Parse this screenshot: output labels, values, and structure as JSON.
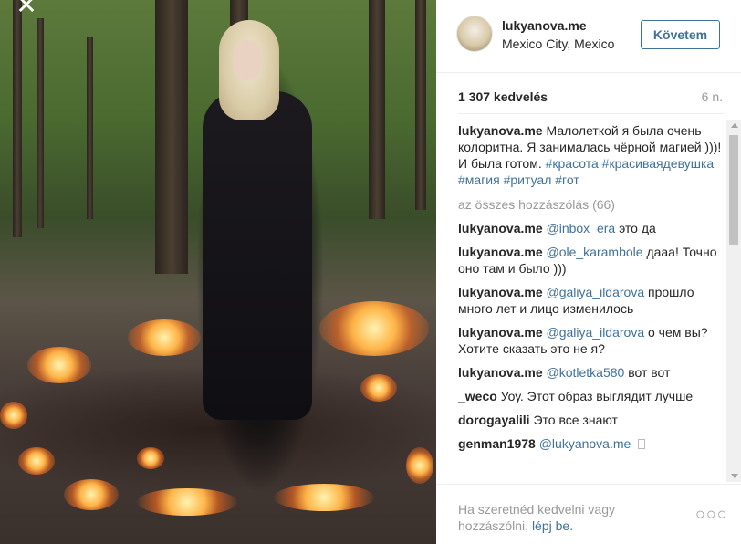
{
  "photo": {
    "close_glyph": "✕"
  },
  "header": {
    "username": "lukyanova.me",
    "location": "Mexico City, Mexico",
    "follow_label": "Követem"
  },
  "stats": {
    "likes": "1 307 kedvelés",
    "time_ago": "6 n."
  },
  "caption": {
    "username": "lukyanova.me",
    "text": "Малолеткой я была очень колоритна. Я занималась чёрной магией )))! И была готом.",
    "hashtags": [
      "#красота",
      "#красиваядевушка",
      "#магия",
      "#ритуал",
      "#гот"
    ]
  },
  "all_comments_label": "az összes hozzászólás (66)",
  "comments": [
    {
      "user": "lukyanova.me",
      "mention": "@inbox_era",
      "text": "это да"
    },
    {
      "user": "lukyanova.me",
      "mention": "@ole_karambole",
      "text": "дааа! Точно оно там и было )))"
    },
    {
      "user": "lukyanova.me",
      "mention": "@galiya_ildarova",
      "text": "прошло много лет и лицо изменилось"
    },
    {
      "user": "lukyanova.me",
      "mention": "@galiya_ildarova",
      "text": "о чем вы? Хотите сказать это не я?"
    },
    {
      "user": "lukyanova.me",
      "mention": "@kotletka580",
      "text": "вот вот"
    },
    {
      "user": "_weco",
      "mention": "",
      "text": "Уоу. Этот образ выглядит лучше"
    },
    {
      "user": "dorogayalili",
      "mention": "",
      "text": "Это все знают"
    },
    {
      "user": "genman1978",
      "mention": "@lukyanova.me",
      "text": ""
    }
  ],
  "footer": {
    "prompt": "Ha szeretnéd kedvelni vagy hozzászólni,",
    "login_label": "lépj be.",
    "more_glyph": "○○○"
  },
  "icons": {
    "close": "close-icon",
    "more": "more-options-icon",
    "unsupported_char": "square-glyph"
  }
}
